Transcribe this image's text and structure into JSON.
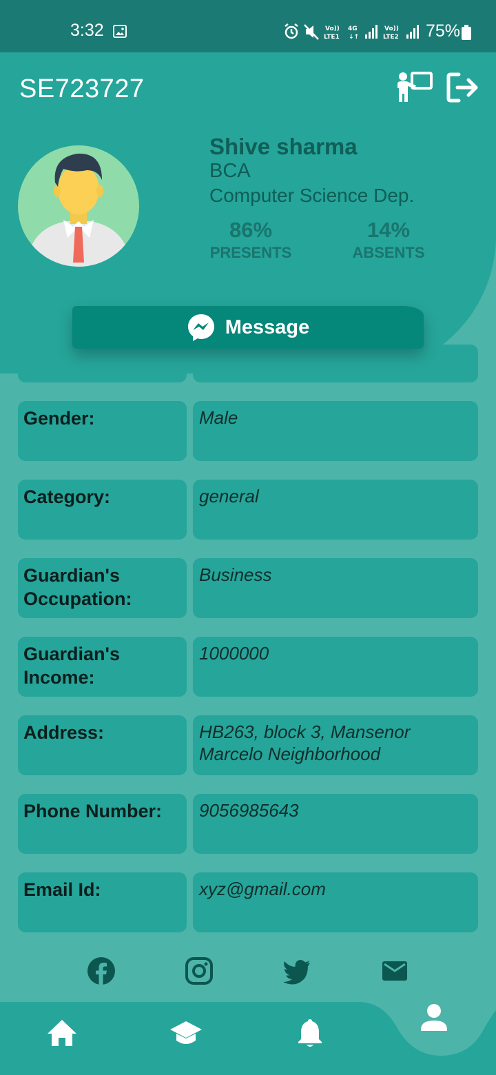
{
  "status_bar": {
    "time": "3:32",
    "battery": "75%",
    "icons": [
      "gallery-icon",
      "alarm-icon",
      "mute-icon",
      "volte-lte1-icon",
      "4g-icon",
      "signal-icon",
      "volte-lte2-icon",
      "signal-icon",
      "battery-icon"
    ]
  },
  "header": {
    "student_id": "SE723727",
    "actions": [
      {
        "name": "teacher-board-icon"
      },
      {
        "name": "logout-icon"
      }
    ],
    "profile": {
      "name": "Shive sharma",
      "course": "BCA",
      "department": "Computer Science Dep."
    },
    "stats": {
      "presents_value": "86%",
      "presents_label": "PRESENTS",
      "absents_value": "14%",
      "absents_label": "ABSENTS"
    },
    "message_button": "Message"
  },
  "details": [
    {
      "label": "Gender:",
      "value": "Male"
    },
    {
      "label": "Category:",
      "value": "general"
    },
    {
      "label": "Guardian's Occupation:",
      "value": "Business"
    },
    {
      "label": "Guardian's Income:",
      "value": "1000000"
    },
    {
      "label": "Address:",
      "value": "HB263, block 3, Mansenor Marcelo Neighborhood"
    },
    {
      "label": "Phone Number:",
      "value": "9056985643"
    },
    {
      "label": "Email Id:",
      "value": "xyz@gmail.com"
    }
  ],
  "social": [
    "facebook-icon",
    "instagram-icon",
    "twitter-icon",
    "email-icon"
  ],
  "bottom_nav": {
    "items": [
      "home-icon",
      "graduation-cap-icon",
      "bell-icon",
      "profile-icon"
    ],
    "active": "profile-icon"
  },
  "colors": {
    "background": "#4db4aa",
    "header": "#26a59a",
    "status_bar": "#1c7a74",
    "accent": "#05877a",
    "text_dark": "#0f5e57"
  }
}
